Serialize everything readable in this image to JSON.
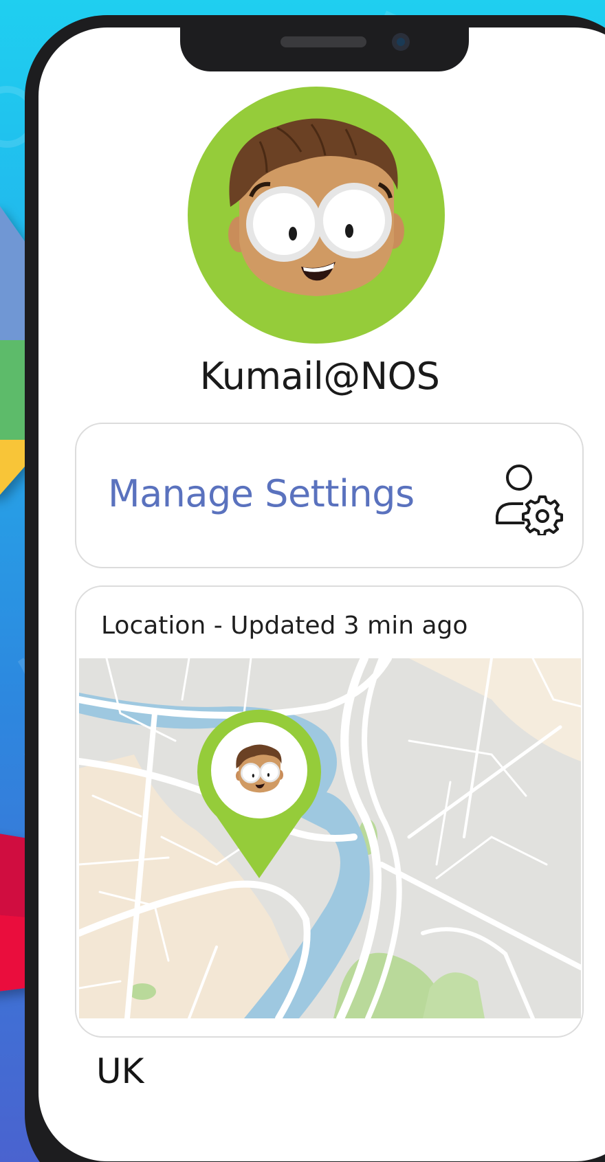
{
  "profile": {
    "username": "Kumail@NOS"
  },
  "settings": {
    "label": "Manage Settings",
    "icon": "user-settings-icon"
  },
  "location": {
    "title": "Location - Updated 3 min ago",
    "country": "UK",
    "marker_icon": "map-pin-icon"
  },
  "colors": {
    "accent_blue": "#5a72be",
    "avatar_green": "#95cc3a",
    "background_cyan": "#1fcff0",
    "background_blue": "#4a63cf"
  }
}
